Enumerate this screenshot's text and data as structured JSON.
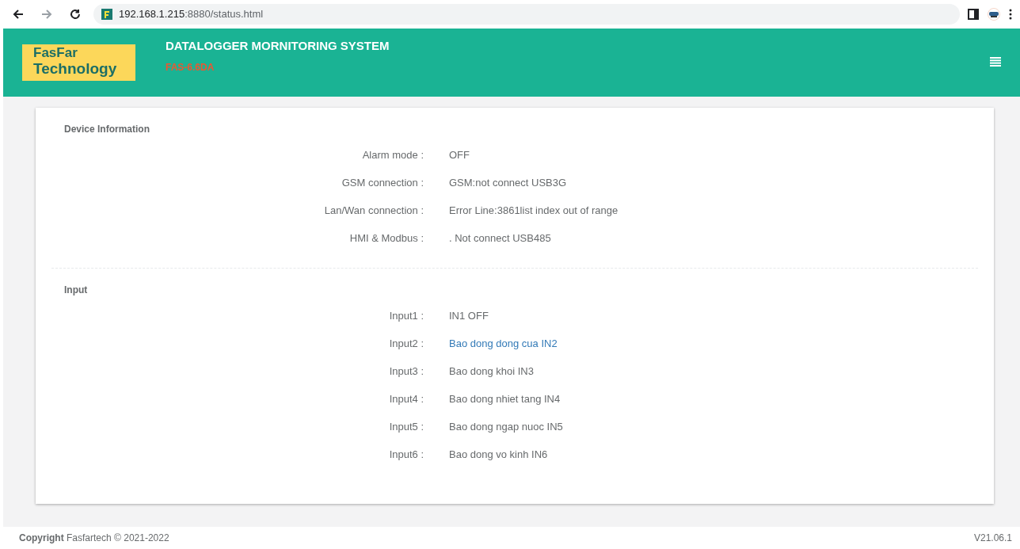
{
  "browser": {
    "url_host": "192.168.1.215",
    "url_rest": ":8880/status.html"
  },
  "header": {
    "logo_line1": "FasFar",
    "logo_line2": "Technology",
    "title": "DATALOGGER MORNITORING SYSTEM",
    "model": "FAS-6.6DA"
  },
  "sections": [
    {
      "title": "Device Information",
      "rows": [
        {
          "label": "Alarm mode :",
          "value": "OFF",
          "kind": "text"
        },
        {
          "label": "GSM connection :",
          "value": "GSM:not connect USB3G",
          "kind": "text"
        },
        {
          "label": "Lan/Wan connection :",
          "value": "Error Line:3861list index out of range",
          "kind": "text"
        },
        {
          "label": "HMI & Modbus :",
          "value": ". Not connect USB485",
          "kind": "text"
        }
      ]
    },
    {
      "title": "Input",
      "rows": [
        {
          "label": "Input1 :",
          "value": "IN1 OFF",
          "kind": "text"
        },
        {
          "label": "Input2 :",
          "value": "Bao dong dong cua IN2",
          "kind": "link"
        },
        {
          "label": "Input3 :",
          "value": "Bao dong khoi IN3",
          "kind": "text"
        },
        {
          "label": "Input4 :",
          "value": "Bao dong nhiet tang IN4",
          "kind": "text"
        },
        {
          "label": "Input5 :",
          "value": "Bao dong ngap nuoc IN5",
          "kind": "text"
        },
        {
          "label": "Input6 :",
          "value": "Bao dong vo kinh IN6",
          "kind": "text"
        }
      ]
    }
  ],
  "footer": {
    "copyright_bold": "Copyright",
    "copyright_rest": "Fasfartech © 2021-2022",
    "version": "V21.06.1"
  }
}
